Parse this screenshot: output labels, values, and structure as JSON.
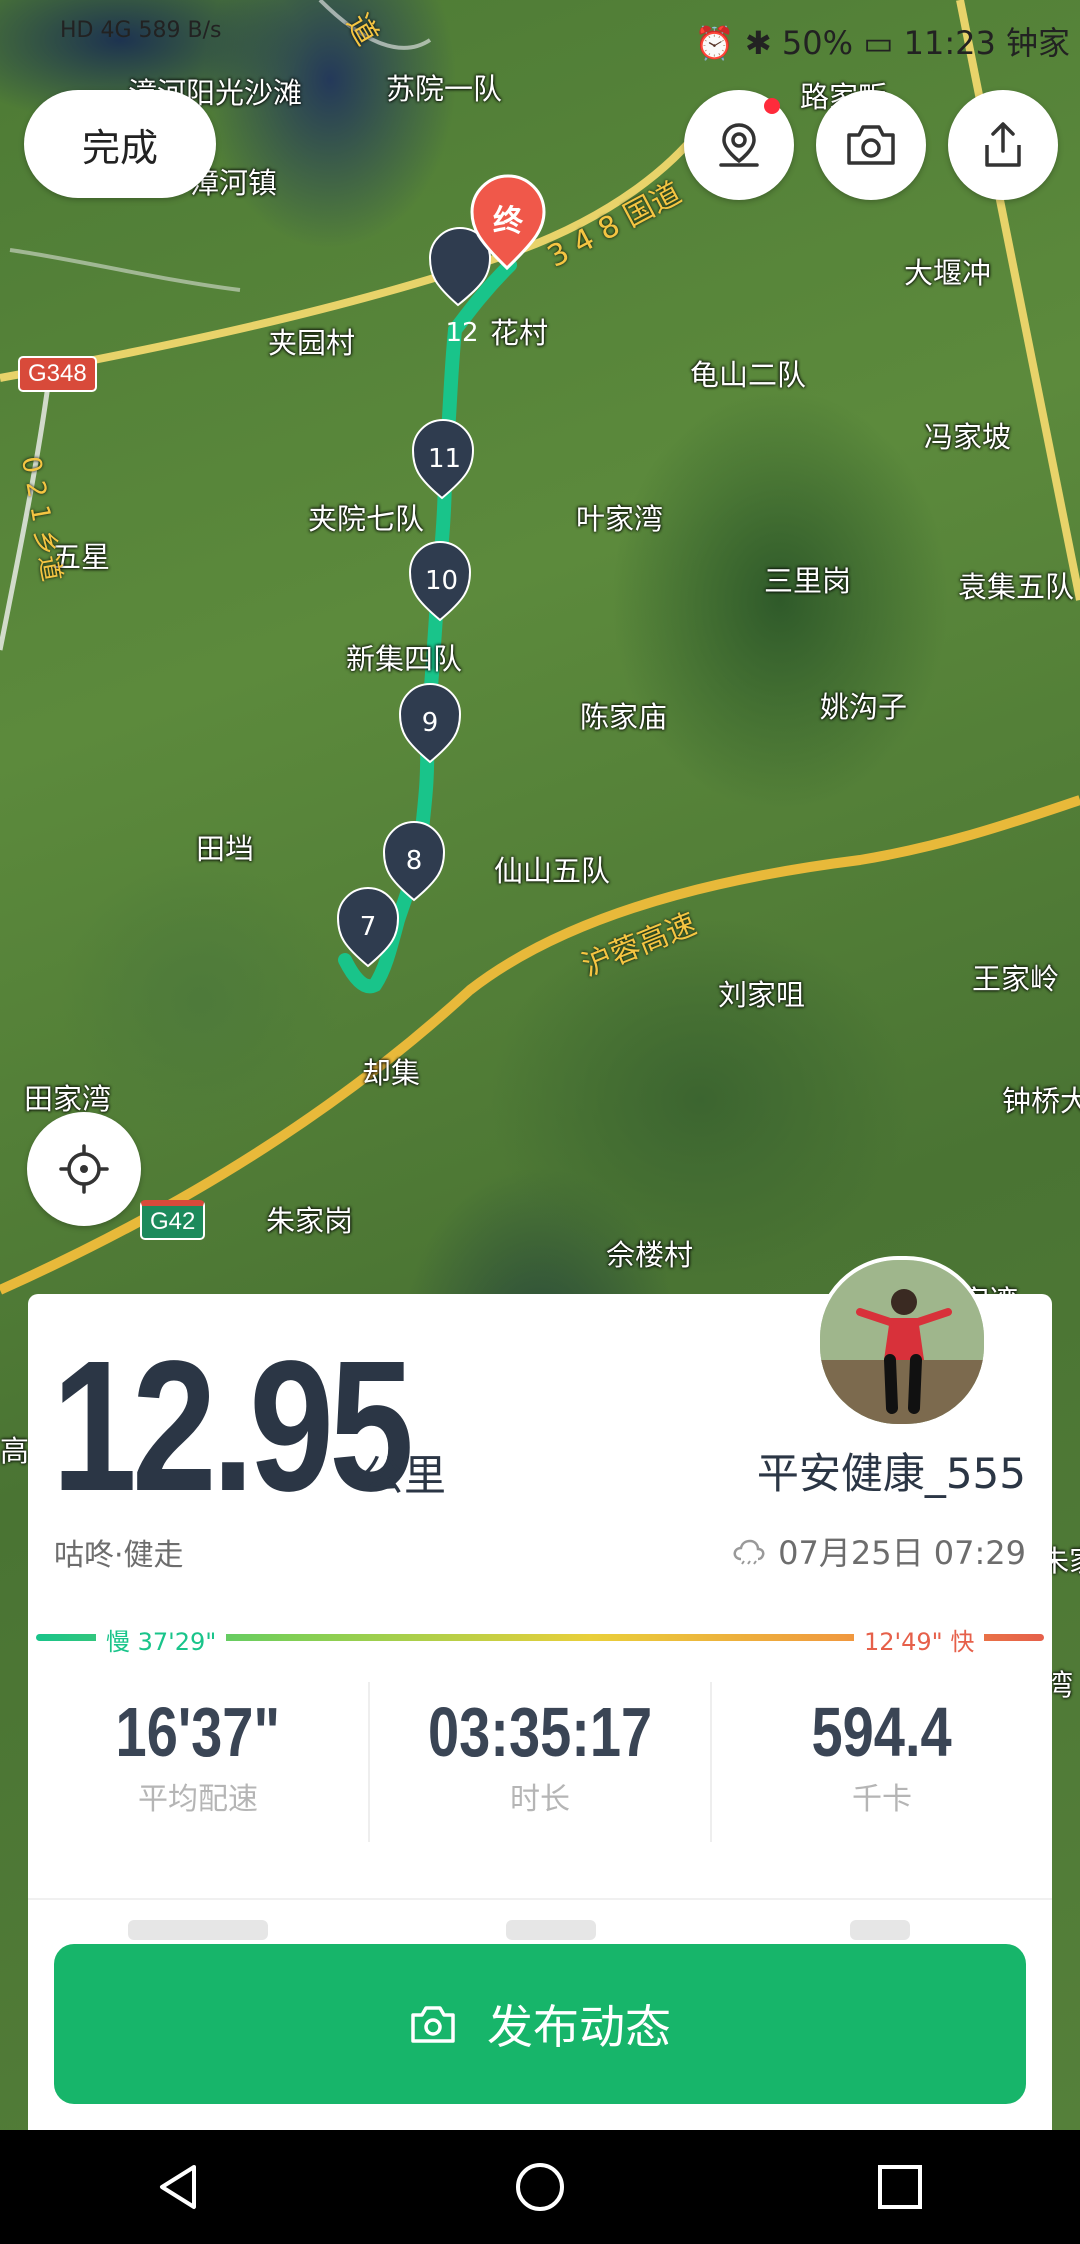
{
  "status_bar": {
    "network": "HD 4G",
    "speed": "589 B/s",
    "battery": "50%",
    "time": "11:23",
    "carrier_extra": "钟家"
  },
  "toolbar": {
    "done_label": "完成"
  },
  "map": {
    "places": [
      "漳河阳光沙滩",
      "苏院一队",
      "路家畈",
      "漳河镇",
      "大堰冲",
      "夹园村",
      "龟山二队",
      "冯家坡",
      "花村",
      "夹院七队",
      "叶家湾",
      "五星",
      "三里岗",
      "袁集五队",
      "新集四队",
      "陈家庙",
      "姚沟子",
      "田垱",
      "仙山五队",
      "刘家咀",
      "王家岭",
      "却集",
      "钟桥大",
      "田家湾",
      "朱家岗",
      "佘楼村",
      "高",
      "朱家",
      "湾",
      "家湾"
    ],
    "road_labels": [
      "3 4 8 国道",
      "沪蓉高速",
      "0 2 1 乡道",
      "道"
    ],
    "shields": [
      "G348",
      "G42"
    ],
    "route_markers": [
      "12",
      "11",
      "10",
      "9",
      "8",
      "7"
    ],
    "end_marker": "终"
  },
  "summary": {
    "distance": "12.95",
    "unit": "公里",
    "username": "平安健康_555",
    "activity": "咕咚·健走",
    "datetime": "07月25日 07:29",
    "pace_slow": "慢 37'29\"",
    "pace_fast": "12'49\" 快",
    "stats": [
      {
        "value": "16'37\"",
        "label": "平均配速"
      },
      {
        "value": "03:35:17",
        "label": "时长"
      },
      {
        "value": "594.4",
        "label": "千卡"
      }
    ]
  },
  "publish": {
    "label": "发布动态"
  },
  "colors": {
    "accent": "#17b56a",
    "route": "#19c48a",
    "pace_fast": "#e6604a"
  }
}
